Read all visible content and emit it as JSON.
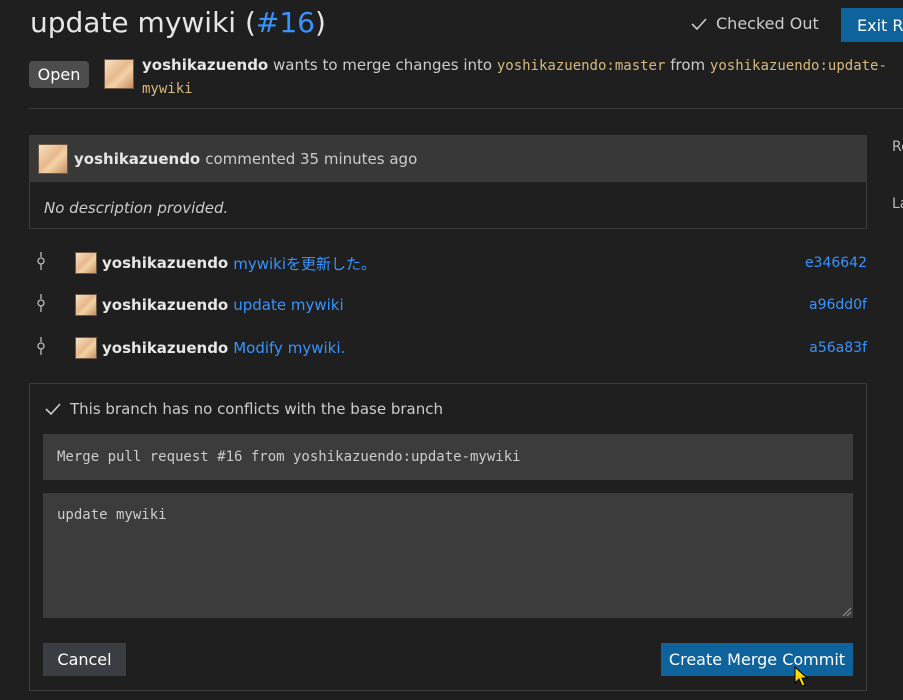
{
  "header": {
    "title": "update mywiki (",
    "number": "#16",
    "title_close": ")",
    "checked_out": "Checked Out",
    "exit_button": "Exit R"
  },
  "pr": {
    "status": "Open",
    "author": "yoshikazuendo",
    "wants_text": "wants to merge changes  into",
    "base_branch": "yoshikazuendo:master",
    "from_text": "from",
    "head_branch": "yoshikazuendo:update-mywiki"
  },
  "sidebar": {
    "item1": "Re",
    "item2": "La"
  },
  "comment": {
    "author": "yoshikazuendo",
    "time_text": "commented 35 minutes ago",
    "body": "No description provided."
  },
  "commits": [
    {
      "author": "yoshikazuendo",
      "message": "mywikiを更新した。",
      "sha": "e346642"
    },
    {
      "author": "yoshikazuendo",
      "message": "update mywiki",
      "sha": "a96dd0f"
    },
    {
      "author": "yoshikazuendo",
      "message": "Modify mywiki.",
      "sha": "a56a83f"
    }
  ],
  "merge": {
    "no_conflicts": "This branch has no conflicts with the base branch",
    "commit_title": "Merge pull request #16 from yoshikazuendo:update-mywiki",
    "commit_message": "update mywiki",
    "cancel_label": "Cancel",
    "create_label": "Create Merge Commit"
  },
  "icons": {
    "check": "check-icon",
    "commit": "git-commit-icon",
    "cursor": "mouse-cursor-icon"
  },
  "colors": {
    "accent": "#3794ff",
    "primary_button": "#0e639c",
    "branch": "#d7ba7d"
  }
}
